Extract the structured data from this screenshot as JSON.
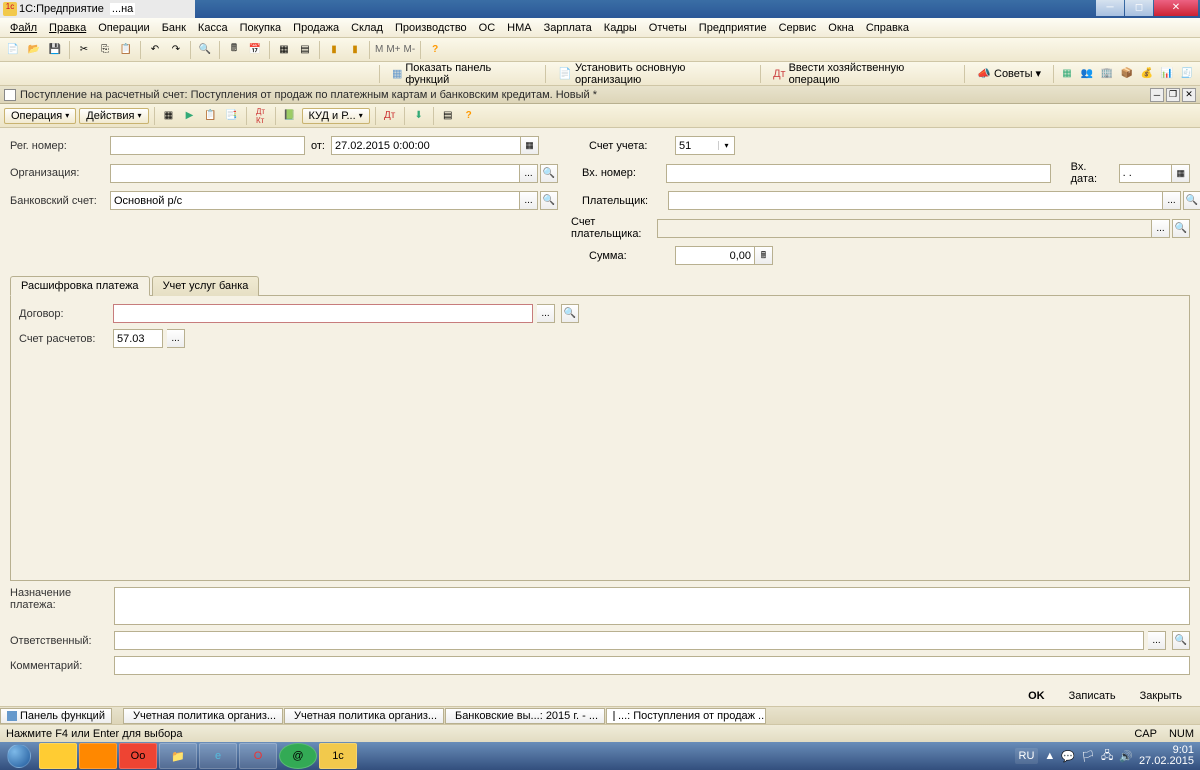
{
  "window": {
    "app_title_prefix": "1С:Предприятие",
    "app_title_rest": "...на"
  },
  "menu": [
    "Файл",
    "Правка",
    "Операции",
    "Банк",
    "Касса",
    "Покупка",
    "Продажа",
    "Склад",
    "Производство",
    "ОС",
    "НМА",
    "Зарплата",
    "Кадры",
    "Отчеты",
    "Предприятие",
    "Сервис",
    "Окна",
    "Справка"
  ],
  "toolbar_text": {
    "m": "M",
    "mplus": "M+",
    "mminus": "M-"
  },
  "toolbar2": {
    "show_panel": "Показать панель функций",
    "set_org": "Установить основную организацию",
    "enter_op": "Ввести хозяйственную операцию",
    "advice": "Советы"
  },
  "doc": {
    "title": "Поступление на расчетный счет: Поступления от продаж по платежным картам и банковским кредитам. Новый *",
    "operation": "Операция",
    "actions": "Действия",
    "kudir": "КУД и Р..."
  },
  "form": {
    "reg_num_label": "Рег. номер:",
    "ot_label": "от:",
    "date_value": "27.02.2015  0:00:00",
    "org_label": "Организация:",
    "bank_acc_label": "Банковский счет:",
    "bank_acc_value": "Основной р/с",
    "account_label": "Счет учета:",
    "account_value": "51",
    "in_num_label": "Вх. номер:",
    "in_date_label": "Вх. дата:",
    "in_date_value": " .  .    ",
    "payer_label": "Плательщик:",
    "payer_acc_label": "Счет плательщика:",
    "sum_label": "Сумма:",
    "sum_value": "0,00"
  },
  "tabs": {
    "tab1": "Расшифровка платежа",
    "tab2": "Учет услуг банка",
    "contract_label": "Договор:",
    "acc_calc_label": "Счет расчетов:",
    "acc_calc_value": "57.03"
  },
  "bottom": {
    "purpose_label": "Назначение платежа:",
    "responsible_label": "Ответственный:",
    "comment_label": "Комментарий:"
  },
  "dlg": {
    "ok": "OK",
    "write": "Записать",
    "close": "Закрыть"
  },
  "wintabs": [
    "Панель функций",
    "Учетная политика организ...",
    "Учетная политика организ...",
    "Банковские вы...: 2015 г. - ...",
    "...: Поступления от продаж ..."
  ],
  "status": {
    "hint": "Нажмите F4 или Enter для выбора",
    "cap": "CAP",
    "num": "NUM"
  },
  "tray": {
    "lang": "RU",
    "time": "9:01",
    "date": "27.02.2015"
  }
}
